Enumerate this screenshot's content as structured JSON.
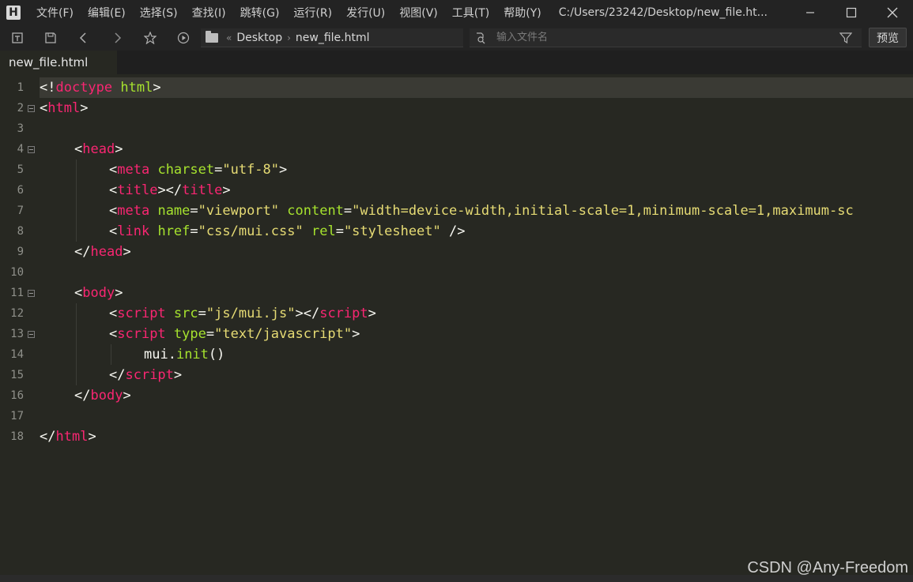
{
  "app": {
    "logo": "H",
    "menu": [
      "文件(F)",
      "编辑(E)",
      "选择(S)",
      "查找(I)",
      "跳转(G)",
      "运行(R)",
      "发行(U)",
      "视图(V)",
      "工具(T)",
      "帮助(Y)"
    ],
    "window_title": "C:/Users/23242/Desktop/new_file.ht..."
  },
  "toolbar": {
    "breadcrumb": [
      "Desktop",
      "new_file.html"
    ],
    "search_placeholder": "输入文件名",
    "preview_label": "预览"
  },
  "tabs": [
    {
      "label": "new_file.html",
      "active": true
    }
  ],
  "editor": {
    "lines": [
      {
        "n": "1",
        "fold": false,
        "current": true,
        "indent": 0,
        "tokens": [
          [
            "punc",
            "<!"
          ],
          [
            "doctype",
            "doctype"
          ],
          [
            "plain",
            " "
          ],
          [
            "attr",
            "html"
          ],
          [
            "punc",
            ">"
          ]
        ]
      },
      {
        "n": "2",
        "fold": true,
        "indent": 0,
        "tokens": [
          [
            "punc",
            "<"
          ],
          [
            "tag",
            "html"
          ],
          [
            "punc",
            ">"
          ]
        ]
      },
      {
        "n": "3",
        "fold": false,
        "indent": 0,
        "tokens": []
      },
      {
        "n": "4",
        "fold": true,
        "indent": 1,
        "tokens": [
          [
            "punc",
            "<"
          ],
          [
            "tag",
            "head"
          ],
          [
            "punc",
            ">"
          ]
        ]
      },
      {
        "n": "5",
        "fold": false,
        "indent": 2,
        "tokens": [
          [
            "punc",
            "<"
          ],
          [
            "tag",
            "meta"
          ],
          [
            "plain",
            " "
          ],
          [
            "attr",
            "charset"
          ],
          [
            "punc",
            "="
          ],
          [
            "str",
            "\"utf-8\""
          ],
          [
            "punc",
            ">"
          ]
        ]
      },
      {
        "n": "6",
        "fold": false,
        "indent": 2,
        "tokens": [
          [
            "punc",
            "<"
          ],
          [
            "tag",
            "title"
          ],
          [
            "punc",
            "></"
          ],
          [
            "tag",
            "title"
          ],
          [
            "punc",
            ">"
          ]
        ]
      },
      {
        "n": "7",
        "fold": false,
        "indent": 2,
        "tokens": [
          [
            "punc",
            "<"
          ],
          [
            "tag",
            "meta"
          ],
          [
            "plain",
            " "
          ],
          [
            "attr",
            "name"
          ],
          [
            "punc",
            "="
          ],
          [
            "str",
            "\"viewport\""
          ],
          [
            "plain",
            " "
          ],
          [
            "attr",
            "content"
          ],
          [
            "punc",
            "="
          ],
          [
            "str",
            "\"width=device-width,initial-scale=1,minimum-scale=1,maximum-sc"
          ]
        ]
      },
      {
        "n": "8",
        "fold": false,
        "indent": 2,
        "tokens": [
          [
            "punc",
            "<"
          ],
          [
            "tag",
            "link"
          ],
          [
            "plain",
            " "
          ],
          [
            "attr",
            "href"
          ],
          [
            "punc",
            "="
          ],
          [
            "str",
            "\"css/mui.css\""
          ],
          [
            "plain",
            " "
          ],
          [
            "attr",
            "rel"
          ],
          [
            "punc",
            "="
          ],
          [
            "str",
            "\"stylesheet\""
          ],
          [
            "plain",
            " "
          ],
          [
            "punc",
            "/>"
          ]
        ]
      },
      {
        "n": "9",
        "fold": false,
        "indent": 1,
        "tokens": [
          [
            "punc",
            "</"
          ],
          [
            "tag",
            "head"
          ],
          [
            "punc",
            ">"
          ]
        ]
      },
      {
        "n": "10",
        "fold": false,
        "indent": 0,
        "tokens": []
      },
      {
        "n": "11",
        "fold": true,
        "indent": 1,
        "tokens": [
          [
            "punc",
            "<"
          ],
          [
            "tag",
            "body"
          ],
          [
            "punc",
            ">"
          ]
        ]
      },
      {
        "n": "12",
        "fold": false,
        "indent": 2,
        "tokens": [
          [
            "punc",
            "<"
          ],
          [
            "tag",
            "script"
          ],
          [
            "plain",
            " "
          ],
          [
            "attr",
            "src"
          ],
          [
            "punc",
            "="
          ],
          [
            "str",
            "\"js/mui.js\""
          ],
          [
            "punc",
            "></"
          ],
          [
            "tag",
            "script"
          ],
          [
            "punc",
            ">"
          ]
        ]
      },
      {
        "n": "13",
        "fold": true,
        "indent": 2,
        "tokens": [
          [
            "punc",
            "<"
          ],
          [
            "tag",
            "script"
          ],
          [
            "plain",
            " "
          ],
          [
            "attr",
            "type"
          ],
          [
            "punc",
            "="
          ],
          [
            "str",
            "\"text/javascript\""
          ],
          [
            "punc",
            ">"
          ]
        ]
      },
      {
        "n": "14",
        "fold": false,
        "indent": 3,
        "tokens": [
          [
            "plain",
            "mui."
          ],
          [
            "fn",
            "init"
          ],
          [
            "plain",
            "()"
          ]
        ]
      },
      {
        "n": "15",
        "fold": false,
        "indent": 2,
        "tokens": [
          [
            "punc",
            "</"
          ],
          [
            "tag",
            "script"
          ],
          [
            "punc",
            ">"
          ]
        ]
      },
      {
        "n": "16",
        "fold": false,
        "indent": 1,
        "tokens": [
          [
            "punc",
            "</"
          ],
          [
            "tag",
            "body"
          ],
          [
            "punc",
            ">"
          ]
        ]
      },
      {
        "n": "17",
        "fold": false,
        "indent": 0,
        "tokens": []
      },
      {
        "n": "18",
        "fold": false,
        "indent": 0,
        "tokens": [
          [
            "punc",
            "</"
          ],
          [
            "tag",
            "html"
          ],
          [
            "punc",
            ">"
          ]
        ]
      }
    ]
  },
  "watermark": "CSDN @Any-Freedom"
}
